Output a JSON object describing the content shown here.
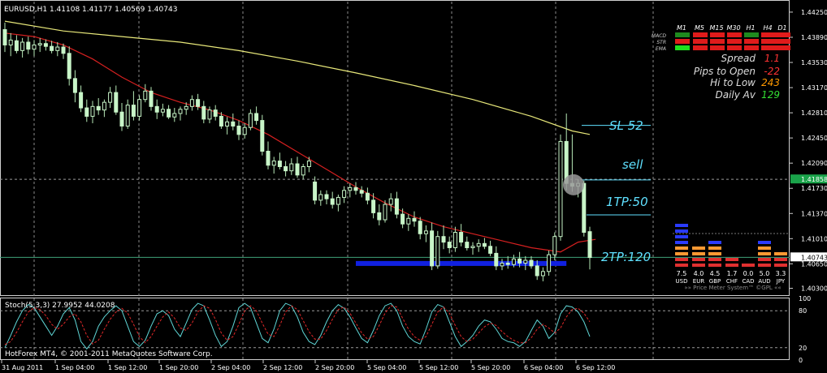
{
  "chart_data": [
    {
      "type": "candlestick",
      "symbol_header": "EURUSD,H1  1.41108 1.41177 1.40569 1.40743",
      "ylim": [
        1.4019,
        1.444
      ],
      "y_tick_labels": [
        "1.44250",
        "1.43890",
        "1.43530",
        "1.43170",
        "1.42810",
        "1.42450",
        "1.42090",
        "1.41730",
        "1.41370",
        "1.41010",
        "1.40650",
        "1.40300"
      ],
      "y_tick_values": [
        1.4425,
        1.4389,
        1.4353,
        1.4317,
        1.4281,
        1.4245,
        1.4209,
        1.4173,
        1.4137,
        1.4101,
        1.4065,
        1.403
      ],
      "current_price_label": "1.40743",
      "current_price": 1.40743,
      "bid_line_label": "1.41858",
      "bid_line": 1.41858,
      "x_tick_labels": [
        "31 Aug 2011",
        "1 Sep 04:00",
        "1 Sep 12:00",
        "1 Sep 20:00",
        "2 Sep 04:00",
        "2 Sep 12:00",
        "2 Sep 20:00",
        "5 Sep 04:00",
        "5 Sep 12:00",
        "5 Sep 20:00",
        "6 Sep 04:00",
        "6 Sep 12:00"
      ],
      "candles": [
        [
          1.44,
          1.441,
          1.4368,
          1.4378
        ],
        [
          1.4378,
          1.4395,
          1.4362,
          1.4385
        ],
        [
          1.4384,
          1.4392,
          1.4366,
          1.437
        ],
        [
          1.437,
          1.4388,
          1.436,
          1.4382
        ],
        [
          1.4382,
          1.439,
          1.4365,
          1.4372
        ],
        [
          1.4372,
          1.4385,
          1.4362,
          1.4378
        ],
        [
          1.4378,
          1.4388,
          1.4368,
          1.438
        ],
        [
          1.438,
          1.4386,
          1.437,
          1.4376
        ],
        [
          1.4376,
          1.4384,
          1.4366,
          1.437
        ],
        [
          1.437,
          1.4382,
          1.4362,
          1.4375
        ],
        [
          1.4375,
          1.438,
          1.4358,
          1.4366
        ],
        [
          1.4366,
          1.4376,
          1.432,
          1.433
        ],
        [
          1.433,
          1.4342,
          1.4296,
          1.431
        ],
        [
          1.431,
          1.432,
          1.4282,
          1.4288
        ],
        [
          1.4288,
          1.43,
          1.4268,
          1.4276
        ],
        [
          1.4276,
          1.4298,
          1.4266,
          1.429
        ],
        [
          1.429,
          1.4302,
          1.4278,
          1.4285
        ],
        [
          1.4285,
          1.43,
          1.4275,
          1.4296
        ],
        [
          1.4296,
          1.4318,
          1.4288,
          1.431
        ],
        [
          1.431,
          1.432,
          1.4278,
          1.4282
        ],
        [
          1.4282,
          1.4295,
          1.4255,
          1.4262
        ],
        [
          1.4262,
          1.43,
          1.4258,
          1.4292
        ],
        [
          1.4292,
          1.4312,
          1.427,
          1.4276
        ],
        [
          1.4276,
          1.4306,
          1.427,
          1.43
        ],
        [
          1.43,
          1.4322,
          1.4296,
          1.4312
        ],
        [
          1.4312,
          1.4318,
          1.4284,
          1.429
        ],
        [
          1.429,
          1.43,
          1.4272,
          1.4282
        ],
        [
          1.4282,
          1.4294,
          1.4276,
          1.4286
        ],
        [
          1.4286,
          1.4292,
          1.4272,
          1.4275
        ],
        [
          1.4275,
          1.4288,
          1.4268,
          1.428
        ],
        [
          1.428,
          1.429,
          1.427,
          1.4286
        ],
        [
          1.4286,
          1.4296,
          1.4278,
          1.429
        ],
        [
          1.429,
          1.4306,
          1.4284,
          1.43
        ],
        [
          1.43,
          1.4308,
          1.4285,
          1.429
        ],
        [
          1.429,
          1.4298,
          1.4266,
          1.4272
        ],
        [
          1.4272,
          1.429,
          1.4266,
          1.4285
        ],
        [
          1.4285,
          1.4292,
          1.427,
          1.4276
        ],
        [
          1.4276,
          1.4282,
          1.4258,
          1.4262
        ],
        [
          1.4262,
          1.4275,
          1.425,
          1.4268
        ],
        [
          1.4268,
          1.428,
          1.4256,
          1.4262
        ],
        [
          1.4262,
          1.427,
          1.4242,
          1.425
        ],
        [
          1.425,
          1.4266,
          1.4244,
          1.426
        ],
        [
          1.426,
          1.4286,
          1.4256,
          1.428
        ],
        [
          1.428,
          1.429,
          1.4264,
          1.427
        ],
        [
          1.427,
          1.4278,
          1.422,
          1.4226
        ],
        [
          1.4226,
          1.424,
          1.42,
          1.4206
        ],
        [
          1.4206,
          1.4218,
          1.4194,
          1.4212
        ],
        [
          1.4212,
          1.4224,
          1.42,
          1.4204
        ],
        [
          1.4204,
          1.4212,
          1.419,
          1.4198
        ],
        [
          1.4198,
          1.4216,
          1.4192,
          1.4208
        ],
        [
          1.4208,
          1.4218,
          1.4188,
          1.4192
        ],
        [
          1.4192,
          1.4208,
          1.4186,
          1.4204
        ],
        [
          1.4204,
          1.4218,
          1.4196,
          1.4212
        ],
        [
          1.4182,
          1.419,
          1.415,
          1.4156
        ],
        [
          1.4156,
          1.417,
          1.4148,
          1.4164
        ],
        [
          1.4164,
          1.417,
          1.415,
          1.4158
        ],
        [
          1.4158,
          1.4168,
          1.4144,
          1.415
        ],
        [
          1.415,
          1.4164,
          1.414,
          1.416
        ],
        [
          1.416,
          1.4176,
          1.4152,
          1.417
        ],
        [
          1.417,
          1.418,
          1.416,
          1.4174
        ],
        [
          1.4174,
          1.4182,
          1.4164,
          1.417
        ],
        [
          1.417,
          1.4176,
          1.416,
          1.4166
        ],
        [
          1.4166,
          1.4174,
          1.415,
          1.4156
        ],
        [
          1.4156,
          1.4166,
          1.413,
          1.4138
        ],
        [
          1.4138,
          1.415,
          1.412,
          1.4128
        ],
        [
          1.4128,
          1.4156,
          1.4124,
          1.415
        ],
        [
          1.415,
          1.4166,
          1.414,
          1.4158
        ],
        [
          1.4158,
          1.4168,
          1.413,
          1.4136
        ],
        [
          1.4136,
          1.4144,
          1.4116,
          1.4122
        ],
        [
          1.4122,
          1.4136,
          1.4112,
          1.413
        ],
        [
          1.413,
          1.414,
          1.4118,
          1.4126
        ],
        [
          1.4126,
          1.4132,
          1.41,
          1.4108
        ],
        [
          1.4108,
          1.412,
          1.4096,
          1.4112
        ],
        [
          1.4112,
          1.4124,
          1.4056,
          1.4062
        ],
        [
          1.4062,
          1.4112,
          1.4058,
          1.4104
        ],
        [
          1.4104,
          1.412,
          1.4086,
          1.4096
        ],
        [
          1.4096,
          1.4104,
          1.408,
          1.4088
        ],
        [
          1.4088,
          1.4118,
          1.4082,
          1.411
        ],
        [
          1.411,
          1.4122,
          1.409,
          1.4096
        ],
        [
          1.4096,
          1.4104,
          1.4084,
          1.4088
        ],
        [
          1.4088,
          1.4096,
          1.4078,
          1.409
        ],
        [
          1.409,
          1.41,
          1.4082,
          1.4094
        ],
        [
          1.4094,
          1.4102,
          1.4086,
          1.409
        ],
        [
          1.409,
          1.4098,
          1.4076,
          1.408
        ],
        [
          1.408,
          1.409,
          1.4056,
          1.4062
        ],
        [
          1.4062,
          1.4072,
          1.4056,
          1.4066
        ],
        [
          1.4066,
          1.4076,
          1.4058,
          1.4064
        ],
        [
          1.4064,
          1.4078,
          1.406,
          1.4072
        ],
        [
          1.4072,
          1.4082,
          1.406,
          1.4066
        ],
        [
          1.4066,
          1.4076,
          1.4056,
          1.407
        ],
        [
          1.407,
          1.4076,
          1.4058,
          1.4062
        ],
        [
          1.4062,
          1.407,
          1.4042,
          1.4048
        ],
        [
          1.4048,
          1.406,
          1.404,
          1.4054
        ],
        [
          1.4054,
          1.4084,
          1.4048,
          1.4078
        ],
        [
          1.4078,
          1.411,
          1.407,
          1.4104
        ],
        [
          1.4104,
          1.425,
          1.4098,
          1.424
        ],
        [
          1.424,
          1.428,
          1.417,
          1.418
        ],
        [
          1.418,
          1.425,
          1.4168,
          1.4176
        ],
        [
          1.4176,
          1.4186,
          1.416,
          1.418
        ],
        [
          1.418,
          1.4184,
          1.4104,
          1.411
        ],
        [
          1.4111,
          1.4118,
          1.4057,
          1.4074
        ]
      ],
      "indicators": [
        {
          "name": "slow moving average",
          "color": "#e8e87a",
          "points": [
            [
              0,
              1.4412
            ],
            [
              10,
              1.4398
            ],
            [
              20,
              1.439
            ],
            [
              30,
              1.4382
            ],
            [
              40,
              1.437
            ],
            [
              50,
              1.4355
            ],
            [
              60,
              1.4338
            ],
            [
              70,
              1.432
            ],
            [
              80,
              1.43
            ],
            [
              90,
              1.4276
            ],
            [
              97,
              1.4255
            ],
            [
              100,
              1.425
            ]
          ]
        },
        {
          "name": "fast moving average",
          "color": "#d62020",
          "points": [
            [
              0,
              1.4395
            ],
            [
              5,
              1.439
            ],
            [
              10,
              1.4378
            ],
            [
              15,
              1.4358
            ],
            [
              20,
              1.4332
            ],
            [
              25,
              1.431
            ],
            [
              30,
              1.4296
            ],
            [
              35,
              1.4285
            ],
            [
              40,
              1.427
            ],
            [
              45,
              1.425
            ],
            [
              50,
              1.4225
            ],
            [
              55,
              1.42
            ],
            [
              60,
              1.4175
            ],
            [
              65,
              1.4152
            ],
            [
              70,
              1.4132
            ],
            [
              75,
              1.4118
            ],
            [
              80,
              1.4108
            ],
            [
              85,
              1.4098
            ],
            [
              90,
              1.4088
            ],
            [
              95,
              1.4082
            ],
            [
              98,
              1.4096
            ],
            [
              101,
              1.41
            ]
          ]
        }
      ],
      "annotations": [
        {
          "label": "SL 52",
          "price": 1.4263
        },
        {
          "label": "sell",
          "price": 1.4185
        },
        {
          "label": "1TP:50",
          "price": 1.4135
        },
        {
          "label": "2TP:120",
          "price": 1.4068
        }
      ],
      "blue_band": {
        "price_low": 1.4062,
        "price_high": 1.4069,
        "from_index": 60,
        "to_index": 96
      }
    },
    {
      "type": "line",
      "title": "Stoch(5,3,3) 27.9952 44.0208",
      "ylim": [
        0,
        100
      ],
      "y_tick_labels": [
        "100",
        "80",
        "20",
        "0"
      ],
      "y_tick_values": [
        100,
        80,
        20,
        0
      ],
      "series": [
        {
          "color": "#5fd6d6",
          "values": [
            20,
            40,
            62,
            80,
            90,
            85,
            70,
            55,
            40,
            55,
            75,
            85,
            65,
            30,
            18,
            30,
            55,
            70,
            80,
            88,
            80,
            55,
            30,
            22,
            32,
            55,
            75,
            80,
            72,
            50,
            38,
            60,
            82,
            92,
            88,
            65,
            40,
            22,
            30,
            55,
            85,
            92,
            85,
            60,
            35,
            28,
            50,
            80,
            92,
            88,
            70,
            45,
            30,
            25,
            40,
            62,
            80,
            90,
            84,
            70,
            52,
            35,
            28,
            48,
            72,
            88,
            92,
            80,
            55,
            38,
            30,
            26,
            50,
            78,
            90,
            86,
            62,
            38,
            22,
            30,
            40,
            55,
            65,
            62,
            50,
            35,
            30,
            28,
            22,
            30,
            48,
            65,
            55,
            35,
            45,
            75,
            88,
            86,
            78,
            62,
            38
          ]
        },
        {
          "color": "#e02828",
          "dash": true,
          "values": [
            25,
            30,
            45,
            62,
            78,
            85,
            82,
            72,
            58,
            50,
            58,
            70,
            75,
            62,
            40,
            26,
            32,
            50,
            66,
            78,
            84,
            76,
            58,
            38,
            28,
            38,
            55,
            70,
            78,
            68,
            52,
            48,
            60,
            78,
            88,
            84,
            66,
            44,
            32,
            38,
            58,
            80,
            88,
            80,
            60,
            42,
            38,
            56,
            78,
            88,
            82,
            64,
            46,
            34,
            34,
            48,
            66,
            82,
            86,
            76,
            60,
            44,
            34,
            38,
            56,
            76,
            88,
            86,
            68,
            50,
            38,
            32,
            38,
            58,
            78,
            86,
            76,
            56,
            38,
            30,
            34,
            44,
            54,
            60,
            56,
            46,
            38,
            32,
            28,
            28,
            36,
            50,
            58,
            52,
            44,
            52,
            70,
            82,
            84,
            76,
            62
          ]
        }
      ]
    }
  ],
  "stoch_footer": "HotForex MT4, © 2001-2011 MetaQuotes Software Corp.",
  "signal_table": {
    "timeframes": [
      "M1",
      "M5",
      "M15",
      "M30",
      "H1",
      "H4",
      "D1"
    ],
    "rows": [
      {
        "label": "MACD",
        "cells": [
          "#1e8a1e",
          "#e01b1b",
          "#e01b1b",
          "#e01b1b",
          "#1e8a1e",
          "#e01b1b",
          "#e01b1b"
        ]
      },
      {
        "label": "STR",
        "cells": [
          "#e01b1b",
          "#e01b1b",
          "#e01b1b",
          "#e01b1b",
          "#e01b1b",
          "#e01b1b",
          "#e01b1b"
        ]
      },
      {
        "label": "EMA",
        "cells": [
          "#1ee01e",
          "#e01b1b",
          "#e01b1b",
          "#e01b1b",
          "#e01b1b",
          "#e01b1b",
          "#e01b1b"
        ]
      }
    ]
  },
  "stats": [
    {
      "label": "Spread",
      "value": "1.1",
      "color": "#ff3333"
    },
    {
      "label": "Pips to Open",
      "value": "-22",
      "color": "#ff3333"
    },
    {
      "label": "Hi to Low",
      "value": "243",
      "color": "#ff9900"
    },
    {
      "label": "Daily Av",
      "value": "129",
      "color": "#33dd33"
    }
  ],
  "price_meter": {
    "currencies": [
      "USD",
      "EUR",
      "GBP",
      "CHF",
      "CAD",
      "AUD",
      "JPY"
    ],
    "values": [
      "7.5",
      "4.0",
      "4.5",
      "1.7",
      "0.0",
      "5.0",
      "3.3"
    ],
    "footer": "»» Price Meter System™ ©GPL ««"
  }
}
